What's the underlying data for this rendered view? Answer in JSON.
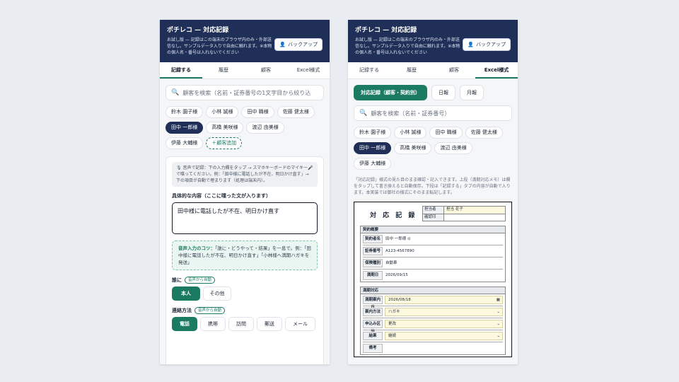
{
  "app": {
    "title": "ポチレコ — 対応記録",
    "notice": "お試し版 — 記録はこの端末のブラウザ内のみ・外部送信なし。サンプルデータ入りで自由に触れます。※本物の個人名・番号は入れないでください",
    "backup_label": "バックアップ"
  },
  "tabs": [
    "記録する",
    "履歴",
    "顧客",
    "Excel様式"
  ],
  "left": {
    "active_tab": 0,
    "search_placeholder": "顧客を検索（名前・証券番号の1文字目から絞り込",
    "customers": [
      "鈴木 園子様",
      "小林 誠様",
      "田中 職様",
      "佐藤 健太様",
      "田中 一郎様",
      "高橋 美咲様",
      "渡辺 由美様",
      "伊藤 大輔様"
    ],
    "selected_customer": "田中 一郎様",
    "add_customer_label": "＋顧客追加",
    "voice_hint": "🎙 音声で記録：下の入力欄をタップ → スマホキーボードのマイキー🎤で喋ってください。例：「田中様に電話したが不在、明日かけ直す」→ 下の項目が自動で埋まります（処理は端末内）。",
    "content_label": "具体的な内容（ここに喋った文が入ります）",
    "content_value": "田中様に電話したが不在、明日かけ直す",
    "tip_title": "音声入力のコツ：",
    "tip_body": "「誰に・どうやって・結果」を一息で。例：「田中様に電話したが不在、明日かけ直す」「小林様へ満期ハガキを発送」",
    "who_label": "誰に",
    "auto_badge": "音声から自動",
    "who_options": [
      "本人",
      "その他"
    ],
    "who_selected": "本人",
    "method_label": "連絡方法",
    "method_options": [
      "電話",
      "携帯",
      "訪問",
      "郵送",
      "メール"
    ],
    "method_selected": "電話"
  },
  "right": {
    "active_tab": 3,
    "subtabs": [
      "対応記録（顧客・契約別）",
      "日報",
      "月報"
    ],
    "subtab_selected": "対応記録（顧客・契約別）",
    "search_placeholder": "顧客を検索（名前・証券番号）",
    "customers": [
      "鈴木 園子様",
      "小林 誠様",
      "田中 職様",
      "佐藤 健太様",
      "田中 一郎様",
      "高橋 美咲様",
      "渡辺 由美様",
      "伊藤 大輔様"
    ],
    "selected_customer": "田中 一郎様",
    "description": "「対応記録」様式の見た目のまま確認・記入できます。上段（満期対応メモ）は欄をタップして書き換えると自動保存。下段は「記録する」タブの内容が自動で入ります。本実装では御社の様式にそのまま転記します。",
    "sheet": {
      "title": "対 応 記 録",
      "staff_label": "担当者",
      "staff_value": "担当 花子",
      "confirm_label": "確認印",
      "contract_section": "契約概要",
      "contract_rows": [
        {
          "k": "契約者名",
          "v": "田中 一郎様",
          "sub": "様"
        },
        {
          "k": "証券番号",
          "v": "A123-4567890"
        },
        {
          "k": "保険種別",
          "v": "自動車"
        },
        {
          "k": "満期日",
          "v": "2026/09/15"
        }
      ],
      "maturity_section": "満期対応",
      "maturity_rows": [
        {
          "k": "満期案内日",
          "v": "2026/08/18",
          "icon": "calendar-icon"
        },
        {
          "k": "案内方法",
          "v": "ハガキ"
        },
        {
          "k": "申込み区分",
          "v": "更改"
        },
        {
          "k": "結果",
          "v": "継続"
        },
        {
          "k": "備考",
          "v": ""
        }
      ]
    }
  },
  "colors": {
    "header": "#1f2f58",
    "accent": "#1b7a62",
    "selected_chip": "#1f2f58"
  }
}
